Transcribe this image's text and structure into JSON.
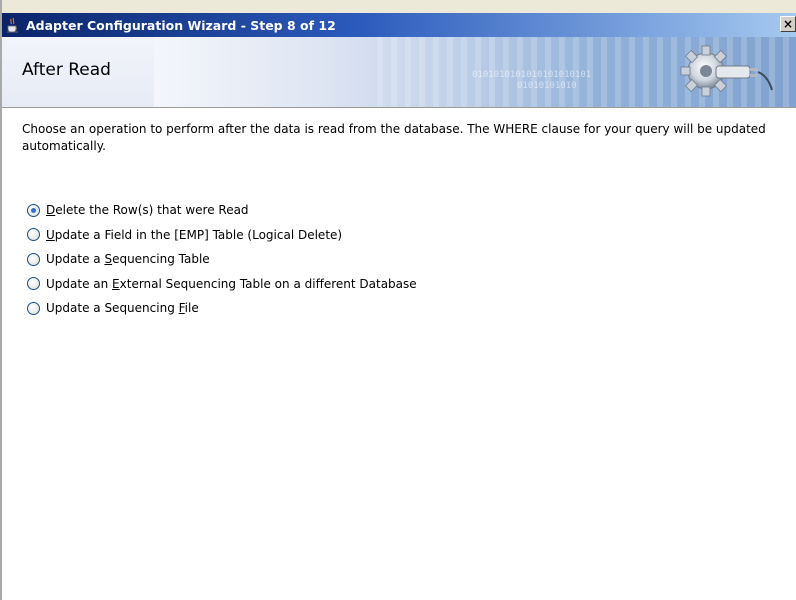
{
  "window": {
    "title": "Adapter Configuration Wizard - Step 8 of 12",
    "close_label": "×",
    "title_icon": "java-cup-icon"
  },
  "header": {
    "title": "After Read",
    "binary_text_1": "0101010101010101010101",
    "binary_text_2": "01010101010",
    "art_icon": "gear-plug-icon"
  },
  "content": {
    "description": "Choose an operation to perform after the data is read from the database.  The WHERE clause for your query will be updated automatically.",
    "options": [
      {
        "pre": "",
        "mnemonic": "D",
        "post": "elete the Row(s) that were Read",
        "selected": true
      },
      {
        "pre": "",
        "mnemonic": "U",
        "post": "pdate a Field in the [EMP] Table (Logical Delete)",
        "selected": false
      },
      {
        "pre": "Update a ",
        "mnemonic": "S",
        "post": "equencing Table",
        "selected": false
      },
      {
        "pre": "Update an ",
        "mnemonic": "E",
        "post": "xternal Sequencing Table on a different Database",
        "selected": false
      },
      {
        "pre": "Update a Sequencing ",
        "mnemonic": "F",
        "post": "ile",
        "selected": false
      }
    ]
  },
  "colors": {
    "titlebar_start": "#0a246a",
    "titlebar_end": "#a6caf0",
    "radio_dot": "#2f6fd1"
  }
}
